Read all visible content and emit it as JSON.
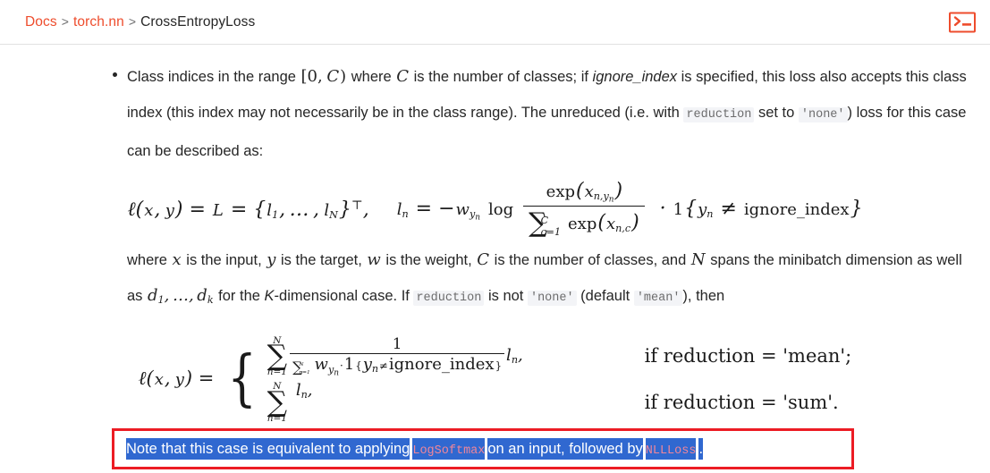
{
  "header": {
    "breadcrumb": [
      {
        "label": "Docs",
        "link": true
      },
      {
        "label": "torch.nn",
        "link": true
      },
      {
        "label": "CrossEntropyLoss",
        "link": false
      }
    ],
    "separator": ">",
    "terminal_icon": "terminal-icon",
    "accent_color": "#ee4c2c"
  },
  "body": {
    "bullet": {
      "t1": "Class indices in the range ",
      "m_range": "[0, C)",
      "t2": " where ",
      "m_C": "C",
      "t3": " is the number of classes; if ",
      "arg_ignore_index": "ignore_index",
      "t4": " is specified, this loss also accepts this class index (this index may not necessarily be in the class range). The unreduced (i.e. with ",
      "code_reduction": "reduction",
      "t5": " set to ",
      "code_none": "'none'",
      "t6": ") loss for this case can be described as:"
    },
    "equation1": {
      "lhs": "ℓ(x, y) = L = {l₁, …, l_N}ᵀ,",
      "rhs_head": "l_n = −w_{y_n} log",
      "fraction_numerator": "exp(x_{n,y_n})",
      "fraction_denominator": "Σ_{c=1}^{C} exp(x_{n,c})",
      "indicator": "· 1{y_n ≠ ignore_index}",
      "plain": "ℓ(x,y) = L = {l_1,...,l_N}^T,  l_n = -w_{y_n} log( exp(x_{n,y_n}) / sum_{c=1}^{C} exp(x_{n,c}) ) · 1{y_n ≠ ignore_index}"
    },
    "paragraph2": {
      "t1": "where ",
      "m_x": "x",
      "t2": " is the input, ",
      "m_y": "y",
      "t3": " is the target, ",
      "m_w": "w",
      "t4": " is the weight, ",
      "m_C": "C",
      "t5": " is the number of classes, and ",
      "m_N": "N",
      "t6": " spans the minibatch dimension as well as ",
      "m_d1": "d_1, …, d_k",
      "t7": " for the ",
      "em_K": "K",
      "t8": "-dimensional case. If ",
      "code_reduction": "reduction",
      "t9": " is not ",
      "code_none": "'none'",
      "t10": " (default ",
      "code_mean": "'mean'",
      "t11": "), then"
    },
    "equation2": {
      "lhs": "ℓ(x, y) =",
      "case1_expr_sum": "Σ_{n=1}^{N}",
      "case1_frac_num": "1",
      "case1_frac_den": "Σ_{n=1}^{N} w_{y_n} · 1{y_n ≠ ignore_index}",
      "case1_tail": "l_n,",
      "case1_cond": "if reduction = 'mean';",
      "case2_expr": "Σ_{n=1}^{N} l_n,",
      "case2_cond": "if reduction = 'sum'.",
      "plain": "ℓ(x,y) = { sum_{n=1}^{N} [ 1 / (sum_{n=1}^{N} w_{y_n}·1{y_n≠ignore_index}) ] l_n,  if reduction = 'mean';  sum_{n=1}^{N} l_n,  if reduction = 'sum'. }"
    }
  },
  "note": {
    "part1": "Note that this case is equivalent to applying",
    "code1": "LogSoftmax",
    "part2": "on an input, followed by",
    "code2": "NLLLoss",
    "part3": ".",
    "selection_color": "#3068d0",
    "selection_text_color": "#ffffff",
    "annotation_box_color": "#ec1c24",
    "code_link_color": "#f0869a"
  }
}
